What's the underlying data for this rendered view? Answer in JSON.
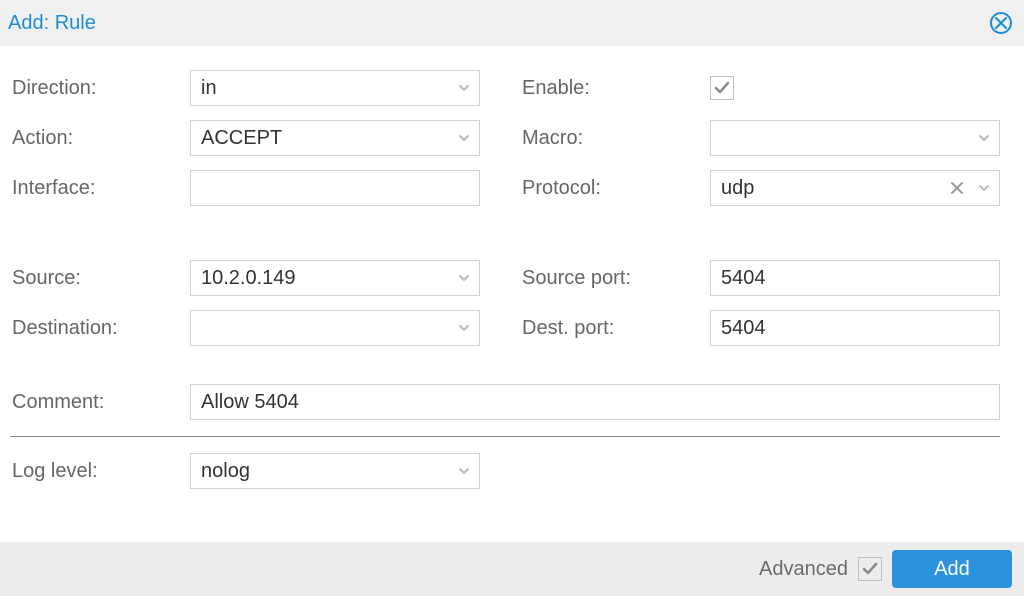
{
  "window": {
    "title": "Add: Rule"
  },
  "labels": {
    "direction": "Direction:",
    "enable": "Enable:",
    "action": "Action:",
    "macro": "Macro:",
    "interface": "Interface:",
    "protocol": "Protocol:",
    "source": "Source:",
    "source_port": "Source port:",
    "destination": "Destination:",
    "dest_port": "Dest. port:",
    "comment": "Comment:",
    "log_level": "Log level:"
  },
  "values": {
    "direction": "in",
    "enable": true,
    "action": "ACCEPT",
    "macro": "",
    "interface": "",
    "protocol": "udp",
    "source": "10.2.0.149",
    "source_port": "5404",
    "destination": "",
    "dest_port": "5404",
    "comment": "Allow 5404",
    "log_level": "nolog"
  },
  "footer": {
    "advanced_label": "Advanced",
    "advanced_checked": true,
    "submit_label": "Add"
  },
  "colors": {
    "accent": "#1F8DD6",
    "primary_button": "#2A93DC"
  }
}
